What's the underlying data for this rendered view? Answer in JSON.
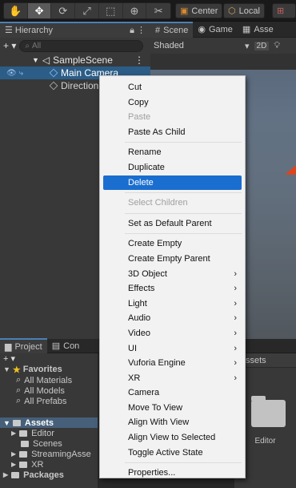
{
  "toolbar": {
    "tools": [
      "hand-icon",
      "move-icon",
      "rotate-icon",
      "scale-icon",
      "rect-icon",
      "transform-icon",
      "custom-tool-icon"
    ],
    "pivot_label": "Center",
    "space_label": "Local"
  },
  "hierarchy": {
    "tab_label": "Hierarchy",
    "search_placeholder": "All",
    "scene_name": "SampleScene",
    "items": [
      "Main Camera",
      "Direction"
    ]
  },
  "scene": {
    "tabs": [
      "Scene",
      "Game",
      "Asse"
    ],
    "shading_label": "Shaded",
    "mode_2d": "2D"
  },
  "project": {
    "tabs": [
      "Project",
      "Con"
    ],
    "favorites_label": "Favorites",
    "favorites": [
      "All Materials",
      "All Models",
      "All Prefabs"
    ],
    "assets_label": "Assets",
    "assets": [
      "Editor",
      "Scenes",
      "StreamingAsse",
      "XR"
    ],
    "packages_label": "Packages",
    "right_header": "ssets",
    "folder_label": "Editor"
  },
  "context_menu": {
    "groups": [
      [
        {
          "label": "Cut"
        },
        {
          "label": "Copy"
        },
        {
          "label": "Paste",
          "disabled": true
        },
        {
          "label": "Paste As Child"
        }
      ],
      [
        {
          "label": "Rename"
        },
        {
          "label": "Duplicate"
        },
        {
          "label": "Delete",
          "highlighted": true
        }
      ],
      [
        {
          "label": "Select Children",
          "disabled": true
        }
      ],
      [
        {
          "label": "Set as Default Parent"
        }
      ],
      [
        {
          "label": "Create Empty"
        },
        {
          "label": "Create Empty Parent"
        },
        {
          "label": "3D Object",
          "submenu": true
        },
        {
          "label": "Effects",
          "submenu": true
        },
        {
          "label": "Light",
          "submenu": true
        },
        {
          "label": "Audio",
          "submenu": true
        },
        {
          "label": "Video",
          "submenu": true
        },
        {
          "label": "UI",
          "submenu": true
        },
        {
          "label": "Vuforia Engine",
          "submenu": true
        },
        {
          "label": "XR",
          "submenu": true
        },
        {
          "label": "Camera"
        },
        {
          "label": "Move To View"
        },
        {
          "label": "Align With View"
        },
        {
          "label": "Align View to Selected"
        },
        {
          "label": "Toggle Active State"
        }
      ],
      [
        {
          "label": "Properties..."
        }
      ]
    ]
  }
}
